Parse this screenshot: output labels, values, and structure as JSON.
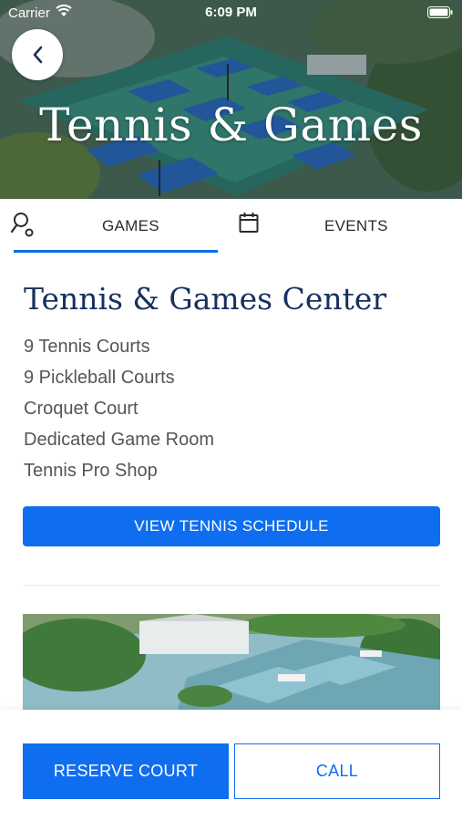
{
  "status_bar": {
    "carrier": "Carrier",
    "time": "6:09 PM",
    "wifi_icon": "wifi-icon",
    "battery_icon": "battery-icon"
  },
  "header": {
    "back_icon": "chevron-left-icon",
    "title": "Tennis & Games"
  },
  "tabs": [
    {
      "label": "GAMES",
      "icon": "racquet-icon",
      "active": true
    },
    {
      "label": "EVENTS",
      "icon": "calendar-icon",
      "active": false
    }
  ],
  "main": {
    "title": "Tennis & Games Center",
    "amenities": [
      "9 Tennis Courts",
      "9 Pickleball Courts",
      "Croquet Court",
      "Dedicated Game Room",
      "Tennis Pro Shop"
    ],
    "schedule_button": "VIEW TENNIS SCHEDULE"
  },
  "footer": {
    "reserve_label": "RESERVE COURT",
    "call_label": "CALL"
  },
  "colors": {
    "accent": "#0f6ef0",
    "title_navy": "#17305e",
    "body_text": "#555555"
  }
}
